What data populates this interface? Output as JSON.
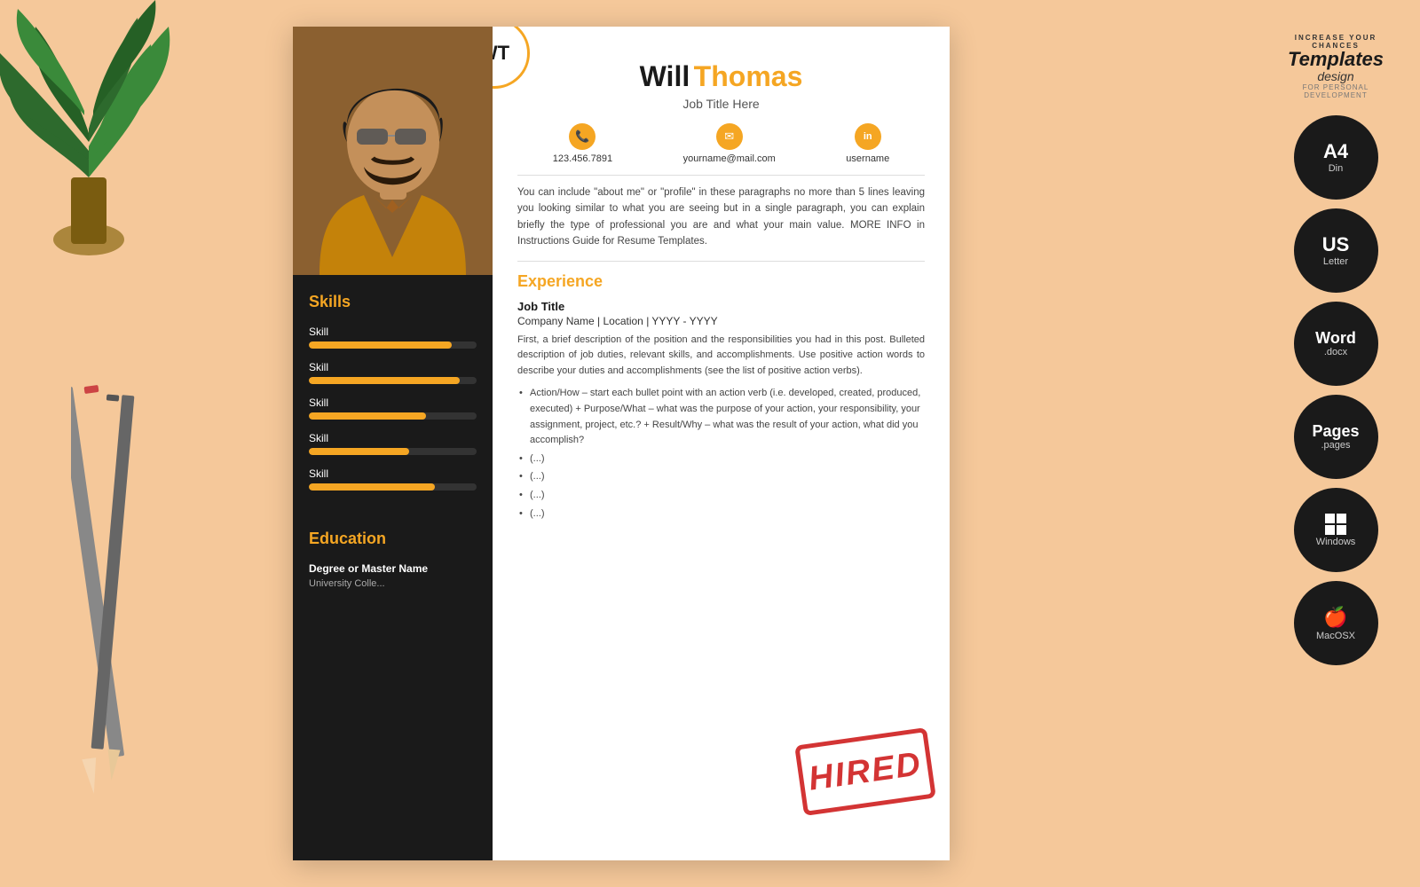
{
  "background": {
    "color": "#f5c89a"
  },
  "logo": {
    "tagline_top": "INCREASE YOUR CHANCES",
    "brand": "Templates",
    "registered": "®",
    "tagline_sub": "design",
    "tagline_bottom": "FOR PERSONAL DEVELOPMENT"
  },
  "badges": [
    {
      "main": "A4",
      "sub": "Din"
    },
    {
      "main": "US",
      "sub": "Letter"
    },
    {
      "main": "Word",
      "sub": ".docx"
    },
    {
      "main": "Pages",
      "sub": ".pages"
    },
    {
      "main": "Windows",
      "sub": ""
    },
    {
      "main": "MacOSX",
      "sub": ""
    }
  ],
  "resume": {
    "monogram": "WT",
    "first_name": "Will",
    "last_name": "Thomas",
    "job_title": "Job Title Here",
    "contact": {
      "phone": "123.456.7891",
      "email": "yourname@mail.com",
      "linkedin": "username"
    },
    "about": "You can include \"about me\" or \"profile\" in these paragraphs no more than 5 lines leaving you looking similar to what you are seeing but in a single paragraph, you can explain briefly the type of professional you are and what your main value. MORE INFO in Instructions Guide for Resume Templates.",
    "experience": {
      "title": "Experience",
      "job_title": "Job Title",
      "company": "Company Name | Location | YYYY - YYYY",
      "description": "First, a brief description of the position and the responsibilities you had in this post. Bulleted description of job duties, relevant skills, and accomplishments. Use positive action words to describe your duties and accomplishments (see the list of positive action verbs).",
      "bullet1": "Action/How – start each bullet point with an action verb (i.e. developed, created, produced, executed) + Purpose/What – what was the purpose of your action, your responsibility, your assignment, project, etc.? + Result/Why – what was the result of your action, what did you accomplish?",
      "bullet2": "(...)",
      "bullet3": "(...)",
      "bullet4": "(...)",
      "bullet5": "(...)"
    },
    "skills": {
      "title": "Skills",
      "items": [
        {
          "label": "Skill",
          "percent": 85
        },
        {
          "label": "Skill",
          "percent": 90
        },
        {
          "label": "Skill",
          "percent": 70
        },
        {
          "label": "Skill",
          "percent": 60
        },
        {
          "label": "Skill",
          "percent": 75
        }
      ]
    },
    "education": {
      "title": "Education",
      "degree": "Degree or Master Name",
      "university": "University Colle..."
    },
    "hired_stamp": "HIRED"
  }
}
